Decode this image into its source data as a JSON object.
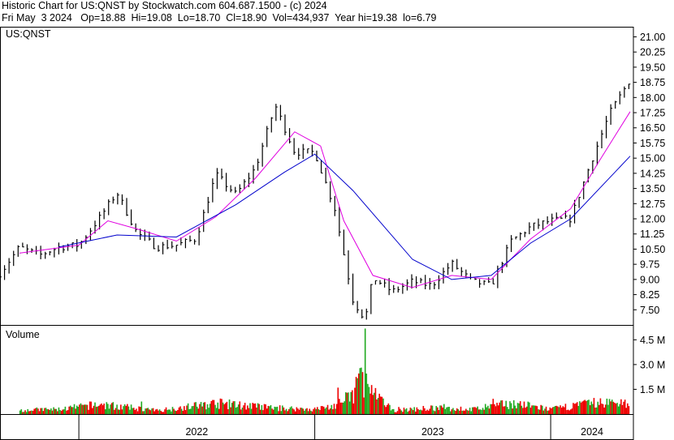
{
  "header": {
    "line1": "Historic Chart for US:QNST by Stockwatch.com 604.687.1500 - (c) 2024",
    "line2": "Fri May  3 2024   Op=18.88  Hi=19.08  Lo=18.70  Cl=18.90  Vol=434,937  Year hi=19.38  lo=6.79"
  },
  "symbol_label": "US:QNST",
  "volume_label": "Volume",
  "colors": {
    "price": "#000000",
    "ma_short": "#e000e0",
    "ma_long": "#0000cc",
    "vol_up": "#22aa22",
    "vol_down": "#ee0000",
    "frame": "#000000"
  },
  "chart_data": {
    "type": "line",
    "title": "Historic Chart for US:QNST",
    "price_axis": {
      "ticks": [
        "21.00",
        "20.25",
        "19.50",
        "18.75",
        "18.00",
        "17.25",
        "16.50",
        "15.75",
        "15.00",
        "14.25",
        "13.50",
        "12.75",
        "12.00",
        "11.25",
        "10.50",
        "9.75",
        "9.00",
        "8.25",
        "7.50"
      ],
      "ylim": [
        6.75,
        21.5
      ]
    },
    "volume_axis": {
      "ticks": [
        "4.5 M",
        "3.0 M",
        "1.5 M"
      ],
      "ylim": [
        0,
        5.4
      ]
    },
    "x_labels": [
      "2022",
      "2023",
      "2024"
    ],
    "x_range": [
      "2021-09",
      "2024-05"
    ],
    "grid": false,
    "price_series": {
      "name": "US:QNST",
      "points": [
        [
          "2021-09-01",
          9.3
        ],
        [
          "2021-10-01",
          10.6
        ],
        [
          "2021-11-01",
          10.2
        ],
        [
          "2021-12-01",
          10.6
        ],
        [
          "2022-01-01",
          10.7
        ],
        [
          "2022-02-01",
          12.0
        ],
        [
          "2022-03-01",
          13.3
        ],
        [
          "2022-04-01",
          11.3
        ],
        [
          "2022-05-01",
          10.6
        ],
        [
          "2022-06-01",
          10.7
        ],
        [
          "2022-07-01",
          11.0
        ],
        [
          "2022-08-01",
          14.2
        ],
        [
          "2022-09-01",
          13.2
        ],
        [
          "2022-10-01",
          14.5
        ],
        [
          "2022-11-01",
          17.6
        ],
        [
          "2022-12-01",
          15.3
        ],
        [
          "2023-01-01",
          15.3
        ],
        [
          "2023-02-01",
          12.5
        ],
        [
          "2023-03-01",
          8.0
        ],
        [
          "2023-03-20",
          7.0
        ],
        [
          "2023-04-01",
          9.1
        ],
        [
          "2023-05-01",
          8.4
        ],
        [
          "2023-06-01",
          8.9
        ],
        [
          "2023-07-01",
          8.7
        ],
        [
          "2023-08-01",
          9.8
        ],
        [
          "2023-09-01",
          8.9
        ],
        [
          "2023-10-01",
          8.7
        ],
        [
          "2023-11-01",
          10.9
        ],
        [
          "2023-12-01",
          11.6
        ],
        [
          "2024-01-01",
          11.9
        ],
        [
          "2024-02-01",
          12.0
        ],
        [
          "2024-03-01",
          14.6
        ],
        [
          "2024-04-01",
          17.2
        ],
        [
          "2024-05-03",
          18.9
        ]
      ]
    },
    "ma_short": {
      "points": [
        [
          "2021-10-01",
          10.3
        ],
        [
          "2022-01-01",
          10.7
        ],
        [
          "2022-02-15",
          11.9
        ],
        [
          "2022-04-01",
          11.5
        ],
        [
          "2022-06-01",
          10.9
        ],
        [
          "2022-08-01",
          12.1
        ],
        [
          "2022-10-01",
          14.0
        ],
        [
          "2022-12-01",
          16.3
        ],
        [
          "2023-01-10",
          15.6
        ],
        [
          "2023-02-15",
          11.9
        ],
        [
          "2023-04-01",
          9.2
        ],
        [
          "2023-06-01",
          8.6
        ],
        [
          "2023-08-01",
          9.2
        ],
        [
          "2023-10-01",
          9.0
        ],
        [
          "2023-12-01",
          11.0
        ],
        [
          "2024-02-01",
          12.5
        ],
        [
          "2024-03-15",
          14.8
        ],
        [
          "2024-05-03",
          17.3
        ]
      ]
    },
    "ma_long": {
      "points": [
        [
          "2021-12-01",
          10.6
        ],
        [
          "2022-03-01",
          11.2
        ],
        [
          "2022-06-01",
          11.1
        ],
        [
          "2022-09-01",
          12.7
        ],
        [
          "2022-11-15",
          14.3
        ],
        [
          "2023-01-01",
          15.2
        ],
        [
          "2023-03-01",
          13.4
        ],
        [
          "2023-06-01",
          10.0
        ],
        [
          "2023-08-01",
          9.0
        ],
        [
          "2023-10-01",
          9.2
        ],
        [
          "2023-12-01",
          10.8
        ],
        [
          "2024-02-01",
          12.0
        ],
        [
          "2024-05-03",
          15.1
        ]
      ]
    },
    "volume_series": {
      "unit": "M",
      "points": [
        [
          "2021-10-01",
          0.35
        ],
        [
          "2021-12-01",
          0.4
        ],
        [
          "2022-02-01",
          0.8
        ],
        [
          "2022-05-01",
          0.3
        ],
        [
          "2022-08-01",
          0.9
        ],
        [
          "2022-11-01",
          0.5
        ],
        [
          "2023-01-01",
          0.4
        ],
        [
          "2023-02-01",
          0.7
        ],
        [
          "2023-03-01",
          1.6
        ],
        [
          "2023-03-10",
          3.3
        ],
        [
          "2023-04-01",
          1.6
        ],
        [
          "2023-05-01",
          0.3
        ],
        [
          "2023-07-01",
          0.5
        ],
        [
          "2023-09-01",
          0.4
        ],
        [
          "2023-11-01",
          0.9
        ],
        [
          "2024-01-01",
          0.4
        ],
        [
          "2024-03-01",
          0.9
        ],
        [
          "2024-05-01",
          1.0
        ]
      ]
    }
  }
}
